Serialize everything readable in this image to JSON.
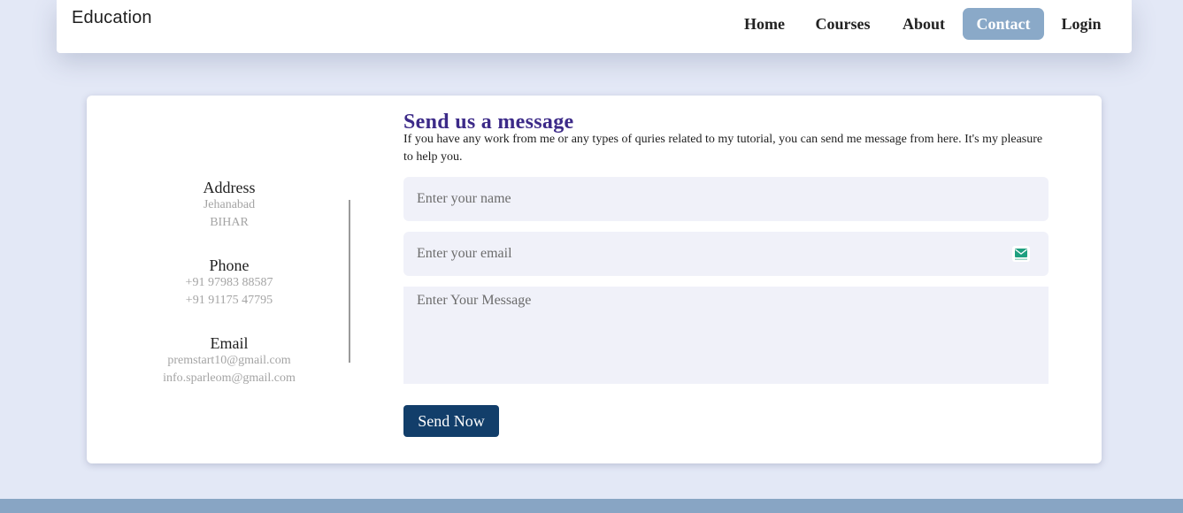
{
  "brand": "Education",
  "nav": {
    "items": [
      {
        "label": "Home",
        "active": false
      },
      {
        "label": "Courses",
        "active": false
      },
      {
        "label": "About",
        "active": false
      },
      {
        "label": "Contact",
        "active": true
      },
      {
        "label": "Login",
        "active": false
      }
    ]
  },
  "contact_info": {
    "address": {
      "heading": "Address",
      "lines": [
        "Jehanabad",
        "BIHAR"
      ]
    },
    "phone": {
      "heading": "Phone",
      "lines": [
        "+91 97983 88587",
        "+91 91175 47795"
      ]
    },
    "email": {
      "heading": "Email",
      "lines": [
        "premstart10@gmail.com",
        "info.sparleom@gmail.com"
      ]
    }
  },
  "form": {
    "title": "Send us a message",
    "description": "If you have any work from me or any types of quries related to my tutorial, you can send me message from here. It's my pleasure to help you.",
    "name_placeholder": "Enter your name",
    "email_placeholder": "Enter your email",
    "message_placeholder": "Enter Your Message",
    "submit_label": "Send Now",
    "email_icon": "envelope-icon"
  },
  "colors": {
    "page_background": "#e3e8f6",
    "nav_active": "#8aa9c8",
    "title": "#3c2a88",
    "button": "#123e6a",
    "field_background": "#f0f1f9",
    "footer": "#88a5c4"
  }
}
